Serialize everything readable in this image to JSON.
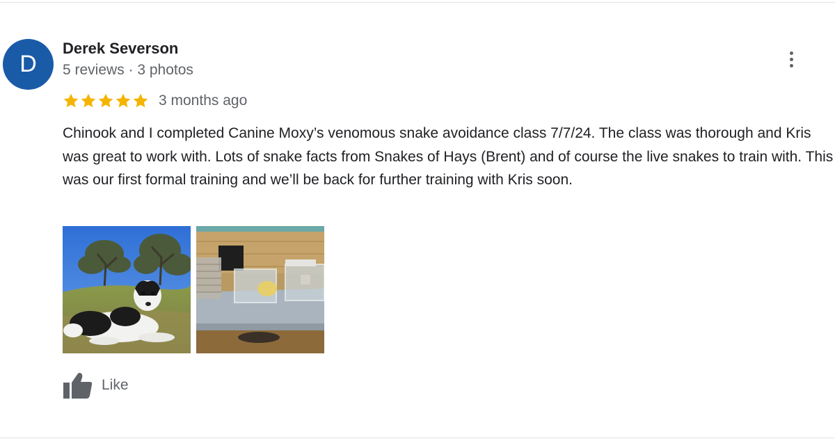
{
  "reviewer": {
    "initial": "D",
    "avatar_color": "#1a5ba8",
    "name": "Derek Severson",
    "meta": "5 reviews · 3 photos"
  },
  "rating": {
    "stars": 5,
    "star_color": "#f4b400",
    "date": "3 months ago"
  },
  "review": {
    "text": "Chinook and I completed Canine Moxy’s venomous snake avoidance class 7/7/24. The class was thorough and Kris was great to work with. Lots of snake facts from Snakes of Hays (Brent) and of course the live snakes to train with. This was our first formal training and we’ll be back for further training with Kris soon."
  },
  "photos": [
    {
      "subject": "dog-lying-on-grass"
    },
    {
      "subject": "snake-enclosures-on-table"
    }
  ],
  "actions": {
    "like_label": "Like",
    "like_icon": "thumbs-up-icon",
    "more_icon": "more-vertical-icon"
  }
}
